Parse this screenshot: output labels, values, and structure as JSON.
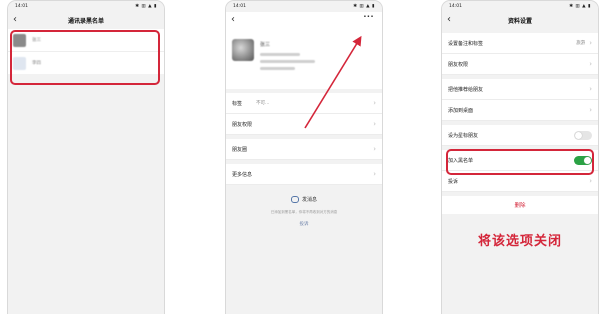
{
  "status_time": "14:01",
  "screen1": {
    "title": "通讯录黑名单",
    "contacts": [
      {
        "name": "张三"
      },
      {
        "name": "李四"
      }
    ]
  },
  "screen2": {
    "name": "张三",
    "rows": [
      {
        "label": "标签",
        "value": "不可..."
      },
      {
        "label": "朋友权限",
        "value": ""
      },
      {
        "label": "朋友圈",
        "value": ""
      },
      {
        "label": "更多信息",
        "value": ""
      }
    ],
    "send_message": "发消息",
    "notice": "已添加到黑名单，你将不再收到对方的消息",
    "complain": "投诉"
  },
  "screen3": {
    "title": "资料设置",
    "rows": [
      {
        "label": "设置备注和标签",
        "value": "旅游"
      },
      {
        "label": "朋友权限",
        "value": ""
      },
      {
        "label": "把他推荐给朋友",
        "value": ""
      },
      {
        "label": "添加到桌面",
        "value": ""
      },
      {
        "label": "设为星标朋友",
        "value": ""
      },
      {
        "label": "加入黑名单",
        "value": ""
      },
      {
        "label": "投诉",
        "value": ""
      }
    ],
    "star_friend_on": false,
    "blacklist_on": true,
    "delete": "删除",
    "instruction": "将该选项关闭"
  },
  "colors": {
    "highlight": "#d4263a",
    "toggle_on": "#2ba245"
  }
}
